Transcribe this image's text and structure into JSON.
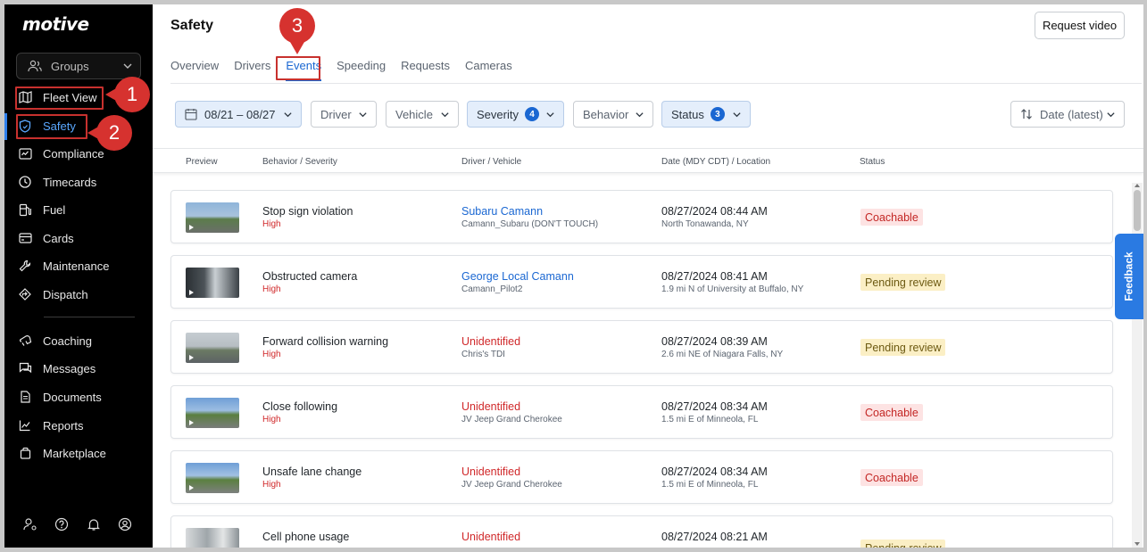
{
  "app": {
    "logo": "motive"
  },
  "sidebar": {
    "groups_label": "Groups",
    "items": [
      {
        "label": "Fleet View",
        "icon": "map-icon"
      },
      {
        "label": "Safety",
        "icon": "shield-icon"
      },
      {
        "label": "Compliance",
        "icon": "compliance-icon"
      },
      {
        "label": "Timecards",
        "icon": "clock-icon"
      },
      {
        "label": "Fuel",
        "icon": "fuel-icon"
      },
      {
        "label": "Cards",
        "icon": "card-icon"
      },
      {
        "label": "Maintenance",
        "icon": "wrench-icon"
      },
      {
        "label": "Dispatch",
        "icon": "dispatch-icon"
      },
      {
        "label": "Coaching",
        "icon": "coaching-icon"
      },
      {
        "label": "Messages",
        "icon": "chat-icon"
      },
      {
        "label": "Documents",
        "icon": "document-icon"
      },
      {
        "label": "Reports",
        "icon": "chart-icon"
      },
      {
        "label": "Marketplace",
        "icon": "bag-icon"
      }
    ],
    "active": "Safety"
  },
  "annotations": {
    "one": "1",
    "two": "2",
    "three": "3"
  },
  "header": {
    "title": "Safety",
    "request_video": "Request video"
  },
  "tabs": [
    {
      "label": "Overview"
    },
    {
      "label": "Drivers"
    },
    {
      "label": "Events"
    },
    {
      "label": "Speeding"
    },
    {
      "label": "Requests"
    },
    {
      "label": "Cameras"
    }
  ],
  "filters": {
    "date": "08/21 – 08/27",
    "driver": "Driver",
    "vehicle": "Vehicle",
    "severity": "Severity",
    "severity_count": "4",
    "behavior": "Behavior",
    "status": "Status",
    "status_count": "3",
    "sort": "Date (latest)"
  },
  "table": {
    "columns": {
      "preview": "Preview",
      "behavior": "Behavior / Severity",
      "driver": "Driver / Vehicle",
      "date": "Date (MDY CDT) / Location",
      "status": "Status"
    },
    "rows": [
      {
        "behavior": "Stop sign violation",
        "severity": "High",
        "driver": "Subaru Camann",
        "vehicle": "Camann_Subaru (DON'T TOUCH)",
        "date": "08/27/2024 08:44 AM",
        "location": "North Tonawanda, NY",
        "status": "Coachable"
      },
      {
        "behavior": "Obstructed camera",
        "severity": "High",
        "driver": "George Local Camann",
        "vehicle": "Camann_Pilot2",
        "date": "08/27/2024 08:41 AM",
        "location": "1.9 mi N of University at Buffalo, NY",
        "status": "Pending review"
      },
      {
        "behavior": "Forward collision warning",
        "severity": "High",
        "driver": "Unidentified",
        "vehicle": "Chris's TDI",
        "date": "08/27/2024 08:39 AM",
        "location": "2.6 mi NE of Niagara Falls, NY",
        "status": "Pending review"
      },
      {
        "behavior": "Close following",
        "severity": "High",
        "driver": "Unidentified",
        "vehicle": "JV Jeep Grand Cherokee",
        "date": "08/27/2024 08:34 AM",
        "location": "1.5 mi E of Minneola, FL",
        "status": "Coachable"
      },
      {
        "behavior": "Unsafe lane change",
        "severity": "High",
        "driver": "Unidentified",
        "vehicle": "JV Jeep Grand Cherokee",
        "date": "08/27/2024 08:34 AM",
        "location": "1.5 mi E of Minneola, FL",
        "status": "Coachable"
      },
      {
        "behavior": "Cell phone usage",
        "severity": "",
        "driver": "Unidentified",
        "vehicle": "",
        "date": "08/27/2024 08:21 AM",
        "location": "",
        "status": "Pending review"
      }
    ]
  },
  "feedback": "Feedback"
}
